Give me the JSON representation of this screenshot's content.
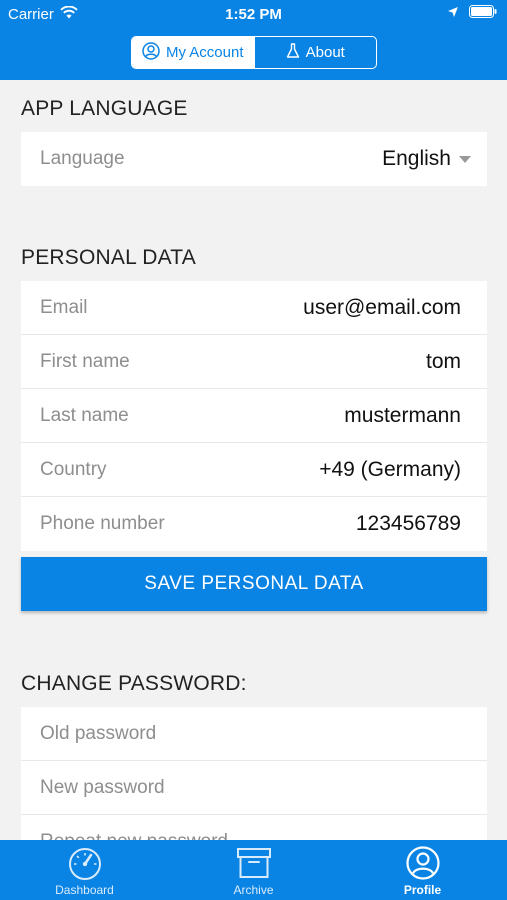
{
  "status_bar": {
    "carrier": "Carrier",
    "time": "1:52 PM"
  },
  "segmented": {
    "my_account": "My Account",
    "about": "About"
  },
  "app_language": {
    "title": "APP LANGUAGE",
    "label": "Language",
    "value": "English"
  },
  "personal_data": {
    "title": "PERSONAL DATA",
    "fields": [
      {
        "label": "Email",
        "value": "user@email.com"
      },
      {
        "label": "First name",
        "value": "tom"
      },
      {
        "label": "Last name",
        "value": "mustermann"
      },
      {
        "label": "Country",
        "value": "+49 (Germany)"
      },
      {
        "label": "Phone number",
        "value": "123456789"
      }
    ],
    "save_label": "SAVE PERSONAL DATA"
  },
  "change_password": {
    "title": "CHANGE PASSWORD:",
    "old_placeholder": "Old password",
    "new_placeholder": "New password",
    "repeat_placeholder": "Repeat new password"
  },
  "tabbar": {
    "dashboard": "Dashboard",
    "archive": "Archive",
    "profile": "Profile"
  },
  "colors": {
    "accent": "#0a84e4",
    "background": "#f2f2f2"
  }
}
